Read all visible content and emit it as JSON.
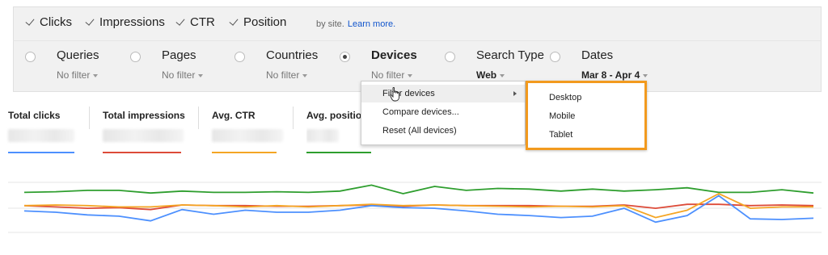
{
  "metrics": {
    "clicks": "Clicks",
    "impressions": "Impressions",
    "ctr": "CTR",
    "position": "Position",
    "note": "by site.",
    "learn_more": "Learn more."
  },
  "dimensions": {
    "queries": {
      "label": "Queries",
      "filter": "No filter"
    },
    "pages": {
      "label": "Pages",
      "filter": "No filter"
    },
    "countries": {
      "label": "Countries",
      "filter": "No filter"
    },
    "devices": {
      "label": "Devices",
      "filter": "No filter"
    },
    "search_type": {
      "label": "Search Type",
      "filter": "Web"
    },
    "dates": {
      "label": "Dates",
      "filter": "Mar 8 - Apr 4"
    }
  },
  "totals": {
    "clicks": "Total clicks",
    "impressions": "Total impressions",
    "ctr": "Avg. CTR",
    "position": "Avg. position"
  },
  "device_menu": {
    "filter": "Filter devices",
    "compare": "Compare devices...",
    "reset": "Reset (All devices)"
  },
  "device_submenu": [
    "Desktop",
    "Mobile",
    "Tablet"
  ],
  "colors": {
    "clicks": "#4d90fe",
    "impressions": "#dd4b39",
    "ctr": "#f4a524",
    "position": "#2e9e2e",
    "highlight": "#f29a1e"
  },
  "chart_data": {
    "type": "line",
    "series": [
      {
        "values": [
          80,
          81,
          83,
          83,
          79,
          82,
          80,
          80,
          81,
          80,
          82,
          91,
          78,
          89,
          83,
          86,
          85,
          82,
          85,
          82,
          84,
          87,
          80,
          80,
          84,
          79
        ]
      },
      {
        "values": [
          60,
          58,
          56,
          57,
          54,
          61,
          60,
          60,
          59,
          59,
          60,
          61,
          59,
          61,
          60,
          60,
          60,
          59,
          59,
          61,
          56,
          62,
          62,
          60,
          61,
          60
        ]
      },
      {
        "values": [
          60,
          61,
          60,
          58,
          58,
          61,
          60,
          58,
          60,
          58,
          60,
          62,
          60,
          61,
          60,
          59,
          58,
          59,
          58,
          60,
          42,
          53,
          78,
          56,
          58,
          58
        ]
      },
      {
        "values": [
          52,
          50,
          46,
          44,
          37,
          54,
          47,
          53,
          50,
          50,
          53,
          60,
          57,
          56,
          52,
          47,
          45,
          42,
          44,
          56,
          35,
          45,
          75,
          40,
          39,
          41
        ]
      }
    ]
  }
}
